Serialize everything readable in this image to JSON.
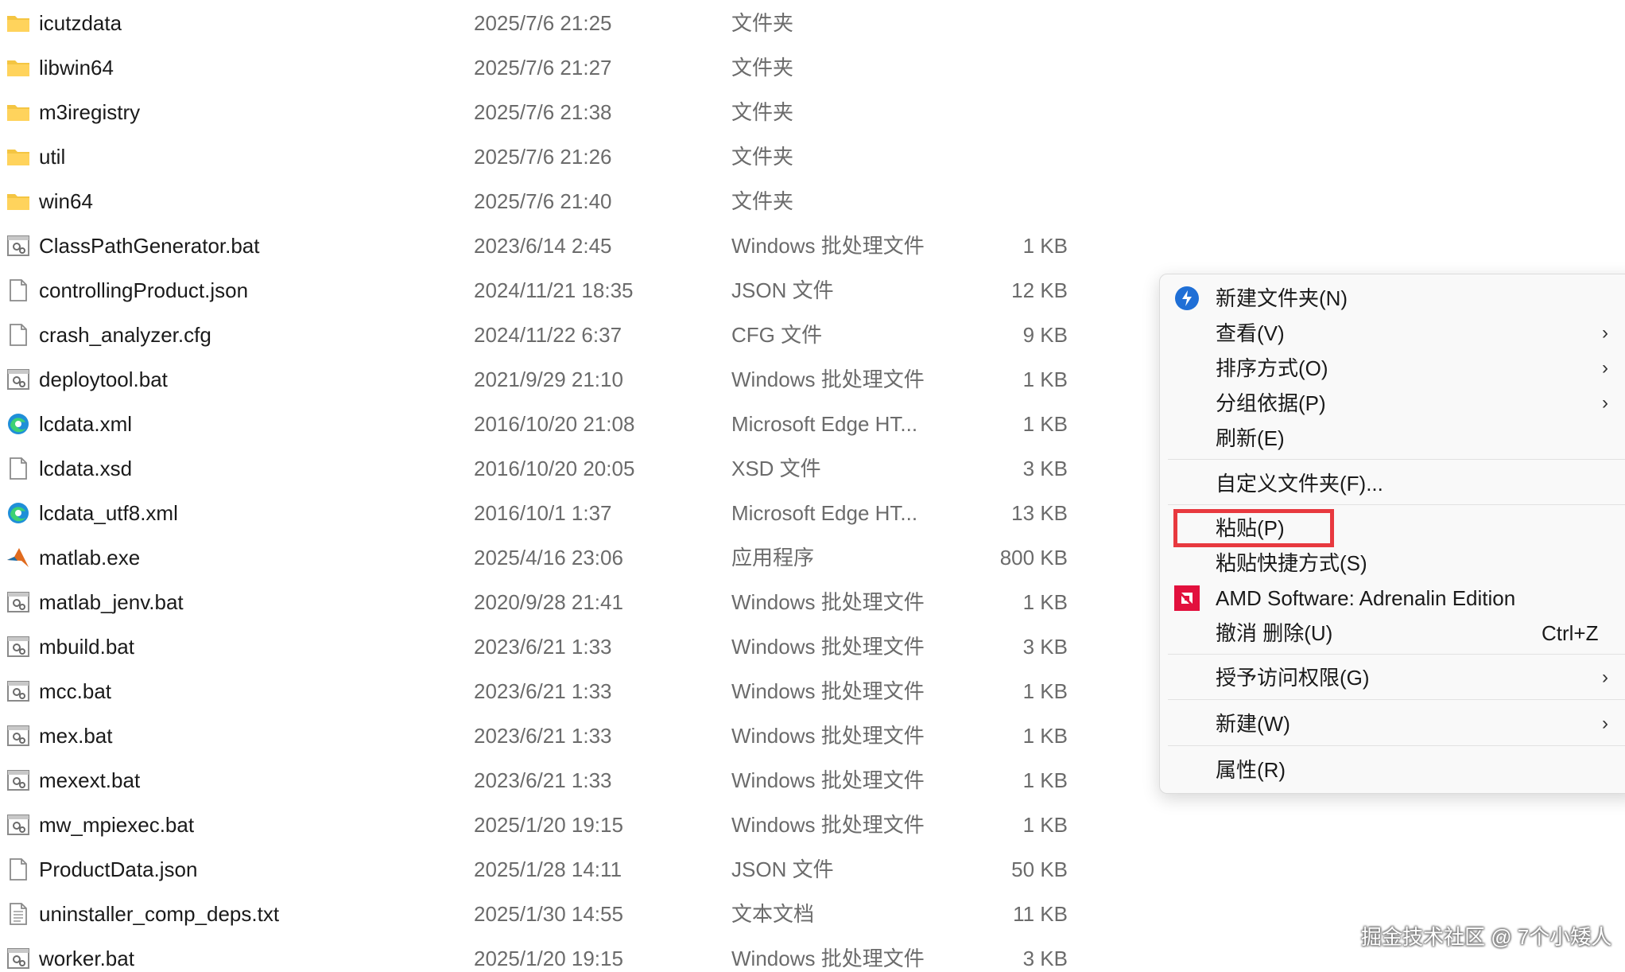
{
  "files": [
    {
      "name": "icutzdata",
      "date": "2025/7/6 21:25",
      "type": "文件夹",
      "size": "",
      "icon": "folder-icon"
    },
    {
      "name": "libwin64",
      "date": "2025/7/6 21:27",
      "type": "文件夹",
      "size": "",
      "icon": "folder-icon"
    },
    {
      "name": "m3iregistry",
      "date": "2025/7/6 21:38",
      "type": "文件夹",
      "size": "",
      "icon": "folder-icon"
    },
    {
      "name": "util",
      "date": "2025/7/6 21:26",
      "type": "文件夹",
      "size": "",
      "icon": "folder-icon"
    },
    {
      "name": "win64",
      "date": "2025/7/6 21:40",
      "type": "文件夹",
      "size": "",
      "icon": "folder-icon"
    },
    {
      "name": "ClassPathGenerator.bat",
      "date": "2023/6/14 2:45",
      "type": "Windows 批处理文件",
      "size": "1 KB",
      "icon": "batch-file-icon"
    },
    {
      "name": "controllingProduct.json",
      "date": "2024/11/21 18:35",
      "type": "JSON 文件",
      "size": "12 KB",
      "icon": "blank-file-icon"
    },
    {
      "name": "crash_analyzer.cfg",
      "date": "2024/11/22 6:37",
      "type": "CFG 文件",
      "size": "9 KB",
      "icon": "blank-file-icon"
    },
    {
      "name": "deploytool.bat",
      "date": "2021/9/29 21:10",
      "type": "Windows 批处理文件",
      "size": "1 KB",
      "icon": "batch-file-icon"
    },
    {
      "name": "lcdata.xml",
      "date": "2016/10/20 21:08",
      "type": "Microsoft Edge HT...",
      "size": "1 KB",
      "icon": "edge-icon"
    },
    {
      "name": "lcdata.xsd",
      "date": "2016/10/20 20:05",
      "type": "XSD 文件",
      "size": "3 KB",
      "icon": "blank-file-icon"
    },
    {
      "name": "lcdata_utf8.xml",
      "date": "2016/10/1 1:37",
      "type": "Microsoft Edge HT...",
      "size": "13 KB",
      "icon": "edge-icon"
    },
    {
      "name": "matlab.exe",
      "date": "2025/4/16 23:06",
      "type": "应用程序",
      "size": "800 KB",
      "icon": "matlab-icon"
    },
    {
      "name": "matlab_jenv.bat",
      "date": "2020/9/28 21:41",
      "type": "Windows 批处理文件",
      "size": "1 KB",
      "icon": "batch-file-icon"
    },
    {
      "name": "mbuild.bat",
      "date": "2023/6/21 1:33",
      "type": "Windows 批处理文件",
      "size": "3 KB",
      "icon": "batch-file-icon"
    },
    {
      "name": "mcc.bat",
      "date": "2023/6/21 1:33",
      "type": "Windows 批处理文件",
      "size": "1 KB",
      "icon": "batch-file-icon"
    },
    {
      "name": "mex.bat",
      "date": "2023/6/21 1:33",
      "type": "Windows 批处理文件",
      "size": "1 KB",
      "icon": "batch-file-icon"
    },
    {
      "name": "mexext.bat",
      "date": "2023/6/21 1:33",
      "type": "Windows 批处理文件",
      "size": "1 KB",
      "icon": "batch-file-icon"
    },
    {
      "name": "mw_mpiexec.bat",
      "date": "2025/1/20 19:15",
      "type": "Windows 批处理文件",
      "size": "1 KB",
      "icon": "batch-file-icon"
    },
    {
      "name": "ProductData.json",
      "date": "2025/1/28 14:11",
      "type": "JSON 文件",
      "size": "50 KB",
      "icon": "blank-file-icon"
    },
    {
      "name": "uninstaller_comp_deps.txt",
      "date": "2025/1/30 14:55",
      "type": "文本文档",
      "size": "11 KB",
      "icon": "text-file-icon"
    },
    {
      "name": "worker.bat",
      "date": "2025/1/20 19:15",
      "type": "Windows 批处理文件",
      "size": "3 KB",
      "icon": "batch-file-icon"
    }
  ],
  "context_menu": {
    "new_folder": "新建文件夹(N)",
    "view": "查看(V)",
    "sort_by": "排序方式(O)",
    "group_by": "分组依据(P)",
    "refresh": "刷新(E)",
    "customize_folder": "自定义文件夹(F)...",
    "paste": "粘贴(P)",
    "paste_shortcut": "粘贴快捷方式(S)",
    "amd_software": "AMD Software: Adrenalin Edition",
    "undo_delete": "撤消 删除(U)",
    "undo_shortcut": "Ctrl+Z",
    "give_access": "授予访问权限(G)",
    "new": "新建(W)",
    "properties": "属性(R)",
    "chevron": "›"
  },
  "watermark": "掘金技术社区 @ 7个小矮人",
  "colors": {
    "folder": "#f4c542",
    "highlight_border": "#e8393f",
    "amd_red": "#e2103d",
    "new_folder_blue": "#1f6fd6"
  }
}
